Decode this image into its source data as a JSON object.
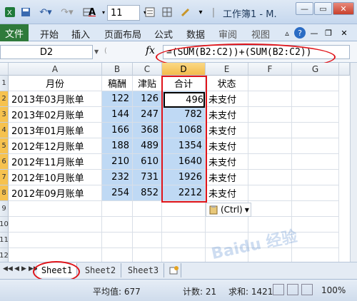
{
  "titlebar": {
    "title": "工作簿1 - M.",
    "font_size_value": "11",
    "font_color_letter": "A"
  },
  "tabs": {
    "file": "文件",
    "items": [
      "开始",
      "插入",
      "页面布局",
      "公式",
      "数据",
      "审阅",
      "视图"
    ]
  },
  "formula_bar": {
    "name_box": "D2",
    "fx": "fx",
    "formula": "=(SUM(B2:C2))+(SUM(B2:C2))"
  },
  "columns": [
    "A",
    "B",
    "C",
    "D",
    "E",
    "F",
    "G"
  ],
  "rows": [
    "1",
    "2",
    "3",
    "4",
    "5",
    "6",
    "7",
    "8",
    "9",
    "10",
    "11",
    "12"
  ],
  "headers": {
    "a": "月份",
    "b": "稿酬",
    "c": "津贴",
    "d": "合计",
    "e": "状态"
  },
  "data_rows": [
    {
      "month": "2013年03月账单",
      "fee": "122",
      "allowance": "126",
      "total": "496",
      "status": "未支付"
    },
    {
      "month": "2013年02月账单",
      "fee": "144",
      "allowance": "247",
      "total": "782",
      "status": "未支付"
    },
    {
      "month": "2013年01月账单",
      "fee": "166",
      "allowance": "368",
      "total": "1068",
      "status": "未支付"
    },
    {
      "month": "2012年12月账单",
      "fee": "188",
      "allowance": "489",
      "total": "1354",
      "status": "未支付"
    },
    {
      "month": "2012年11月账单",
      "fee": "210",
      "allowance": "610",
      "total": "1640",
      "status": "未支付"
    },
    {
      "month": "2012年10月账单",
      "fee": "232",
      "allowance": "731",
      "total": "1926",
      "status": "未支付"
    },
    {
      "month": "2012年09月账单",
      "fee": "254",
      "allowance": "852",
      "total": "2212",
      "status": "未支付"
    }
  ],
  "paste_options": {
    "label": "(Ctrl)"
  },
  "sheets": [
    "Sheet1",
    "Sheet2",
    "Sheet3"
  ],
  "status": {
    "average": "平均值: 677",
    "count": "计数: 21",
    "sum": "求和: 1421",
    "zoom": "100%"
  },
  "colors": {
    "highlight": "#bfd9f4",
    "annotation_red": "#e0141a",
    "file_tab": "#2f7a3b",
    "selected_header": "#f6c24f"
  }
}
